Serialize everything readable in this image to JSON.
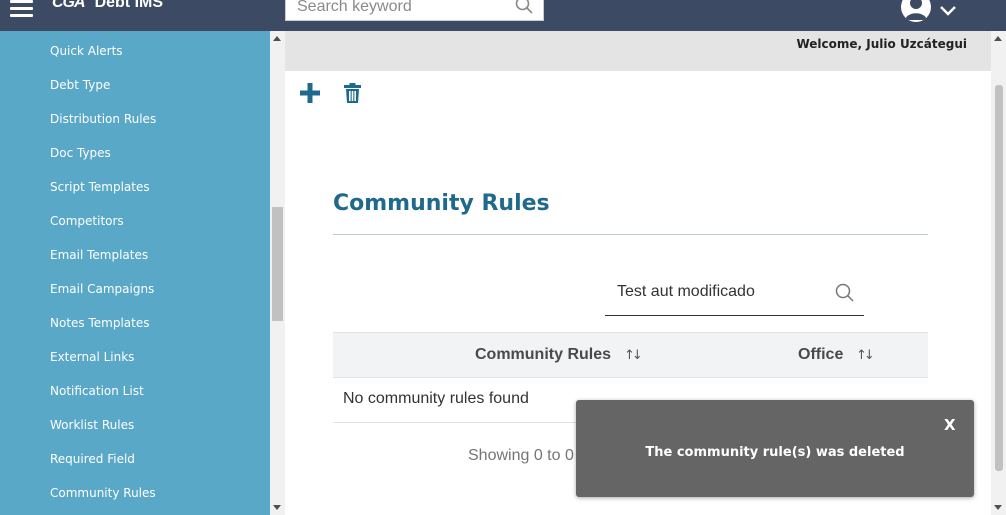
{
  "header": {
    "logo_brand": "CGA",
    "logo_product": "Debt IMS",
    "search_placeholder": "Search keyword",
    "icons": [
      "hamburger-menu-icon",
      "search-icon",
      "user-avatar-icon",
      "chevron-down-icon"
    ]
  },
  "sidebar": {
    "items": [
      {
        "label": "Quick Alerts"
      },
      {
        "label": "Debt Type"
      },
      {
        "label": "Distribution Rules"
      },
      {
        "label": "Doc Types"
      },
      {
        "label": "Script Templates"
      },
      {
        "label": "Competitors"
      },
      {
        "label": "Email Templates"
      },
      {
        "label": "Email Campaigns"
      },
      {
        "label": "Notes Templates"
      },
      {
        "label": "External Links"
      },
      {
        "label": "Notification List"
      },
      {
        "label": "Worklist Rules"
      },
      {
        "label": "Required Field"
      },
      {
        "label": "Community Rules"
      }
    ]
  },
  "welcome": "Welcome, Julio Uzcátegui",
  "toolbar": {
    "icons": [
      "plus-icon",
      "trash-icon"
    ]
  },
  "main": {
    "title": "Community Rules",
    "filter_value": "Test aut modificado",
    "table": {
      "columns": [
        "Community Rules",
        "Office"
      ],
      "sort_glyph": "↑↓",
      "empty_message": "No community rules found"
    },
    "pagination_text": "Showing 0 to 0"
  },
  "toast": {
    "close_label": "X",
    "message": "The community rule(s) was deleted"
  },
  "colors": {
    "topbar": "#3d4a63",
    "sidebar": "#5aa8c8",
    "accent": "#1f6a8c",
    "toast": "#656565"
  }
}
